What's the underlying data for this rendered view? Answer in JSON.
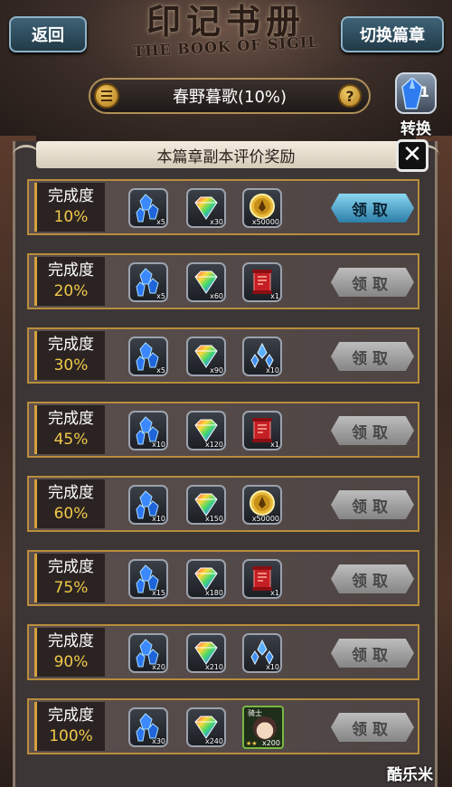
{
  "header": {
    "back_label": "返回",
    "switch_label": "切换篇章",
    "logo_main": "印记书册",
    "logo_sub": "THE BOOK OF SIGIL"
  },
  "chapter": {
    "title": "春野暮歌(10%)",
    "help": "?"
  },
  "convert": {
    "count": "1",
    "label": "转换"
  },
  "panel": {
    "title": "本篇章副本评价奖励",
    "close": "X"
  },
  "rows": [
    {
      "title": "完成度",
      "pct": "10%",
      "r1": "x5",
      "r2": "x30",
      "r3": "x50000",
      "claim": "领取",
      "active": true
    },
    {
      "title": "完成度",
      "pct": "20%",
      "r1": "x5",
      "r2": "x60",
      "r3": "x1",
      "claim": "领取",
      "active": false
    },
    {
      "title": "完成度",
      "pct": "30%",
      "r1": "x5",
      "r2": "x90",
      "r3": "x10",
      "claim": "领取",
      "active": false
    },
    {
      "title": "完成度",
      "pct": "45%",
      "r1": "x10",
      "r2": "x120",
      "r3": "x1",
      "claim": "领取",
      "active": false
    },
    {
      "title": "完成度",
      "pct": "60%",
      "r1": "x10",
      "r2": "x150",
      "r3": "x50000",
      "claim": "领取",
      "active": false
    },
    {
      "title": "完成度",
      "pct": "75%",
      "r1": "x15",
      "r2": "x180",
      "r3": "x1",
      "claim": "领取",
      "active": false
    },
    {
      "title": "完成度",
      "pct": "90%",
      "r1": "x20",
      "r2": "x210",
      "r3": "x10",
      "claim": "领取",
      "active": false
    },
    {
      "title": "完成度",
      "pct": "100%",
      "r1": "x30",
      "r2": "x240",
      "r3": "x200",
      "claim": "领取",
      "active": false,
      "char_name": "骑士",
      "char_stars": "★★"
    }
  ],
  "reward_icons": {
    "r1": "blue-crystal-icon",
    "r2": "rainbow-gem-icon",
    "r3_by_row": [
      "gold-coin-icon",
      "red-scroll-icon",
      "blue-shard-icon",
      "red-scroll-icon",
      "gold-coin-icon",
      "red-scroll-icon",
      "blue-shard-icon",
      "character-card-icon"
    ]
  },
  "colors": {
    "accent_gold": "#b88d3c",
    "claim_active": "#4aa8d2",
    "claim_disabled": "#9e9e9e"
  },
  "watermark": "酷乐米"
}
